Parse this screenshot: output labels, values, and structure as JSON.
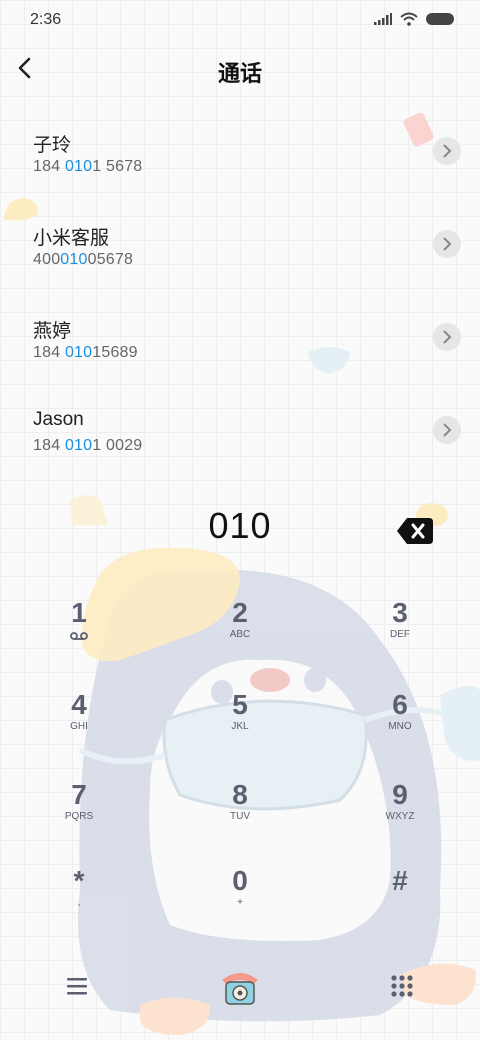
{
  "status_bar": {
    "time": "2:36"
  },
  "header": {
    "title": "通话"
  },
  "contacts": [
    {
      "name": "子玲",
      "num_pre": "184 ",
      "num_hl": "0101",
      "num_post": " 5678",
      "num_hl_text": "010",
      "num_hl_rest": "1"
    },
    {
      "name": "小米客服",
      "num_pre": "400",
      "num_hl": "010",
      "num_post": "05678"
    },
    {
      "name": "燕婷",
      "num_pre": "184 ",
      "num_hl": "010",
      "num_post": "15689"
    },
    {
      "name": "Jason",
      "num_pre": "184 ",
      "num_hl": "010",
      "num_post": "1 0029"
    }
  ],
  "dialer": {
    "digits": "010"
  },
  "keypad": [
    {
      "num": "1",
      "sub": "voicemail-icon"
    },
    {
      "num": "2",
      "sub": "ABC"
    },
    {
      "num": "3",
      "sub": "DEF"
    },
    {
      "num": "4",
      "sub": "GHI"
    },
    {
      "num": "5",
      "sub": "JKL"
    },
    {
      "num": "6",
      "sub": "MNO"
    },
    {
      "num": "7",
      "sub": "PQRS"
    },
    {
      "num": "8",
      "sub": "TUV"
    },
    {
      "num": "9",
      "sub": "WXYZ"
    },
    {
      "num": "*",
      "sub": ","
    },
    {
      "num": "0",
      "sub": "+"
    },
    {
      "num": "#",
      "sub": ""
    }
  ],
  "colors": {
    "highlight": "#1b8fe0",
    "key_text": "#5a6070"
  }
}
